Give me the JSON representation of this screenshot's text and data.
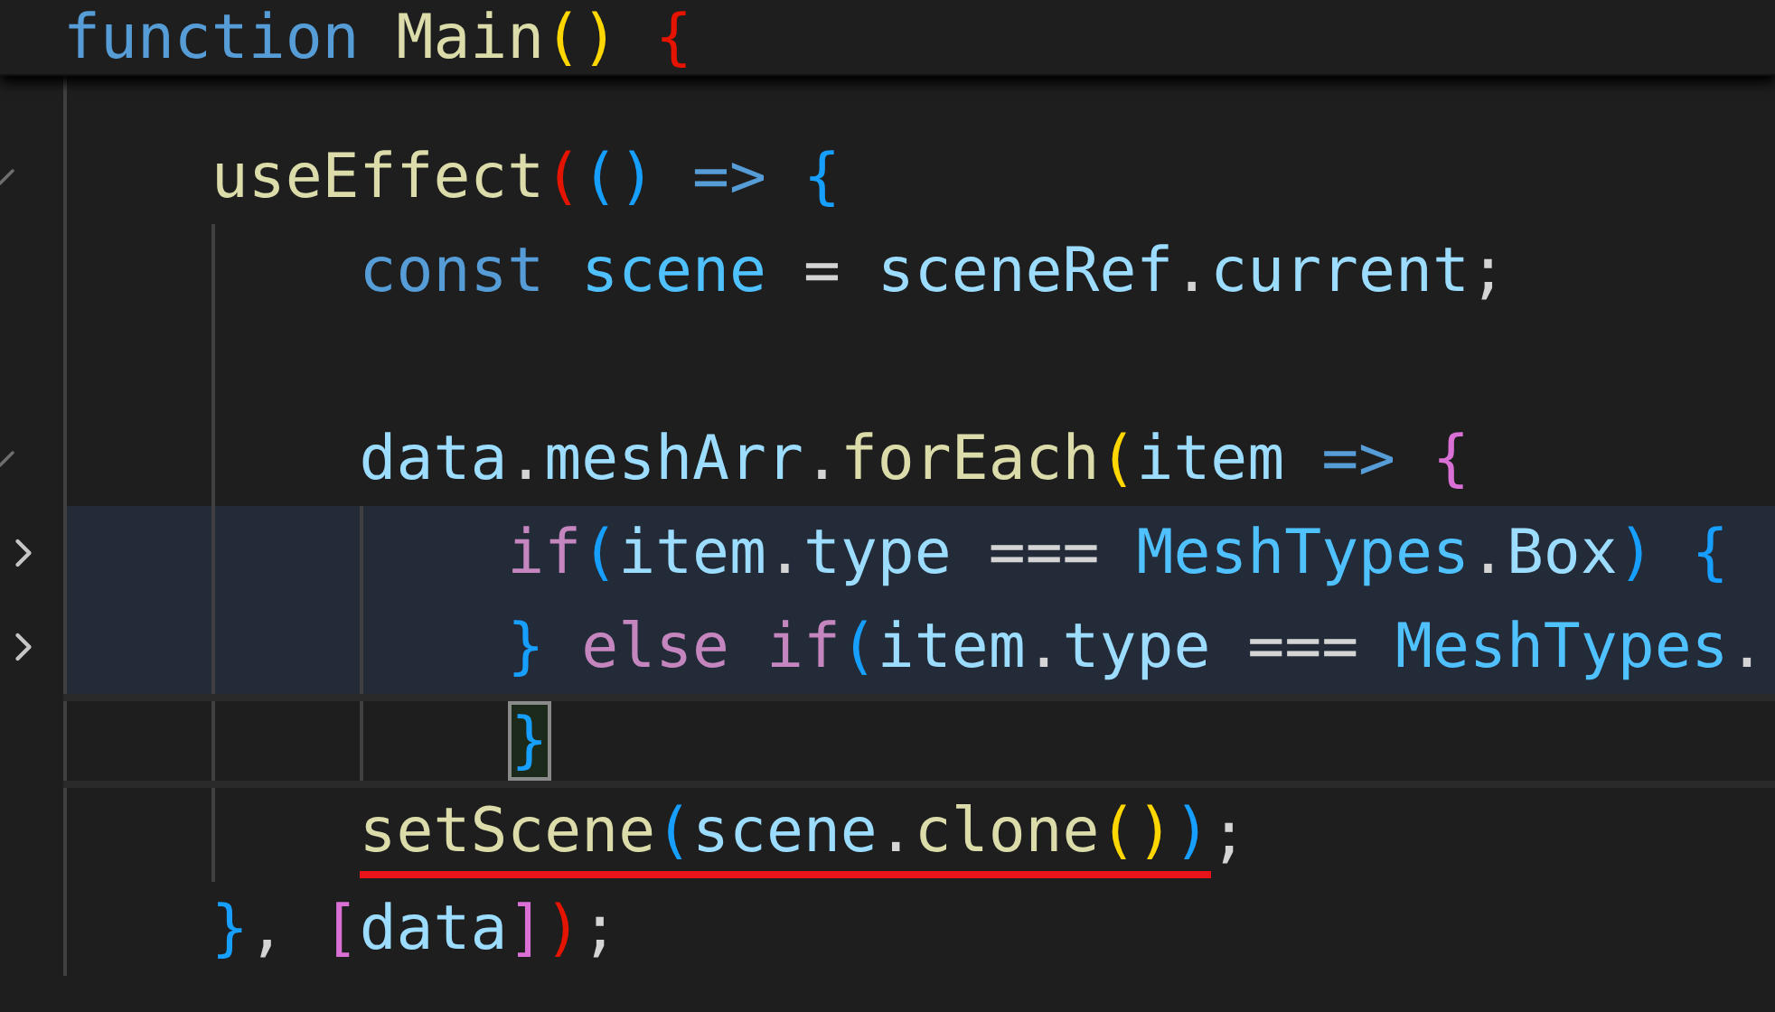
{
  "sticky_header": {
    "tokens": [
      {
        "text": "function ",
        "kind": "keyword"
      },
      {
        "text": "Main",
        "kind": "function"
      },
      {
        "text": "() ",
        "kind": "bracket_yellow"
      },
      {
        "text": "{",
        "kind": "bracket_red"
      }
    ]
  },
  "lines": [
    {
      "highlighted": false,
      "current": false
    },
    {
      "expanded": true,
      "highlighted": false,
      "current": false,
      "tokens": [
        {
          "text": "useEffect",
          "kind": "function"
        },
        {
          "text": "(",
          "kind": "bracket_red"
        },
        {
          "text": "() ",
          "kind": "bracket_blue"
        },
        {
          "text": "=> ",
          "kind": "keyword"
        },
        {
          "text": "{",
          "kind": "bracket_blue"
        }
      ],
      "children": [
        {
          "highlighted": false,
          "current": false,
          "tokens": [
            {
              "text": "const ",
              "kind": "keyword"
            },
            {
              "text": "scene",
              "kind": "constant"
            },
            {
              "text": " = ",
              "kind": "plain"
            },
            {
              "text": "sceneRef",
              "kind": "variable"
            },
            {
              "text": ".",
              "kind": "plain"
            },
            {
              "text": "current",
              "kind": "variable"
            },
            {
              "text": ";",
              "kind": "plain"
            }
          ]
        },
        {
          "highlighted": false,
          "current": false
        },
        {
          "expanded": true,
          "highlighted": false,
          "current": false,
          "tokens": [
            {
              "text": "data",
              "kind": "variable"
            },
            {
              "text": ".",
              "kind": "plain"
            },
            {
              "text": "meshArr",
              "kind": "variable"
            },
            {
              "text": ".",
              "kind": "plain"
            },
            {
              "text": "forEach",
              "kind": "function"
            },
            {
              "text": "(",
              "kind": "bracket_yellow"
            },
            {
              "text": "item ",
              "kind": "variable"
            },
            {
              "text": "=> ",
              "kind": "keyword"
            },
            {
              "text": "{",
              "kind": "bracket_pink"
            }
          ],
          "children": [
            {
              "expanded": false,
              "highlighted": true,
              "current": false,
              "tokens": [
                {
                  "text": "if",
                  "kind": "control"
                },
                {
                  "text": "(",
                  "kind": "bracket_blue"
                },
                {
                  "text": "item",
                  "kind": "variable"
                },
                {
                  "text": ".",
                  "kind": "plain"
                },
                {
                  "text": "type",
                  "kind": "variable"
                },
                {
                  "text": " === ",
                  "kind": "plain"
                },
                {
                  "text": "MeshTypes",
                  "kind": "constant"
                },
                {
                  "text": ".",
                  "kind": "plain"
                },
                {
                  "text": "Box",
                  "kind": "variable"
                },
                {
                  "text": ") {",
                  "kind": "bracket_blue"
                }
              ]
            },
            {
              "expanded": false,
              "highlighted": true,
              "current": false,
              "tokens": [
                {
                  "text": "} ",
                  "kind": "bracket_blue"
                },
                {
                  "text": "else if",
                  "kind": "control"
                },
                {
                  "text": "(",
                  "kind": "bracket_blue"
                },
                {
                  "text": "item",
                  "kind": "variable"
                },
                {
                  "text": ".",
                  "kind": "plain"
                },
                {
                  "text": "type",
                  "kind": "variable"
                },
                {
                  "text": " === ",
                  "kind": "plain"
                },
                {
                  "text": "MeshTypes",
                  "kind": "constant"
                },
                {
                  "text": ".",
                  "kind": "plain"
                }
              ]
            },
            {
              "highlighted": false,
              "current": true,
              "tokens": [
                {
                  "text": "}",
                  "kind": "bracket_blue",
                  "matched": true
                }
              ]
            }
          ]
        },
        {
          "highlighted": false,
          "current": false,
          "tokens": [
            {
              "kind": "underline",
              "tokens": [
                {
                  "text": "setScene",
                  "kind": "function"
                },
                {
                  "text": "(",
                  "kind": "bracket_blue"
                },
                {
                  "text": "scene",
                  "kind": "variable"
                },
                {
                  "text": ".",
                  "kind": "plain"
                },
                {
                  "text": "clone",
                  "kind": "function"
                },
                {
                  "text": "()",
                  "kind": "bracket_yellow"
                },
                {
                  "text": ")",
                  "kind": "bracket_blue"
                }
              ]
            },
            {
              "text": ";",
              "kind": "plain"
            }
          ]
        }
      ]
    },
    {
      "highlighted": false,
      "current": false,
      "tokens": [
        {
          "text": "}",
          "kind": "bracket_blue"
        },
        {
          "text": ", ",
          "kind": "plain"
        },
        {
          "text": "[",
          "kind": "bracket_pink"
        },
        {
          "text": "data",
          "kind": "variable"
        },
        {
          "text": "]",
          "kind": "bracket_pink"
        },
        {
          "text": ")",
          "kind": "bracket_red"
        },
        {
          "text": ";",
          "kind": "plain"
        }
      ]
    }
  ]
}
